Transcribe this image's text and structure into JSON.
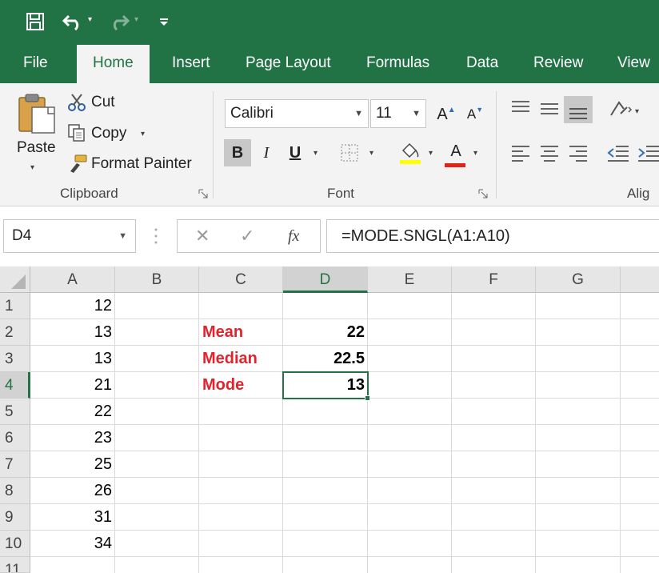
{
  "quick_access": {
    "colors": {
      "ribbon_green": "#217346",
      "ribbon_bg": "#f3f3f3",
      "label_red": "#e0242e"
    }
  },
  "tabs": [
    {
      "label": "File"
    },
    {
      "label": "Home"
    },
    {
      "label": "Insert"
    },
    {
      "label": "Page Layout"
    },
    {
      "label": "Formulas"
    },
    {
      "label": "Data"
    },
    {
      "label": "Review"
    },
    {
      "label": "View"
    }
  ],
  "ribbon": {
    "clipboard": {
      "paste_label": "Paste",
      "cut_label": "Cut",
      "copy_label": "Copy",
      "format_painter_label": "Format Painter",
      "group_label": "Clipboard"
    },
    "font": {
      "font_name": "Calibri",
      "font_size": "11",
      "bold_label": "B",
      "italic_label": "I",
      "underline_label": "U",
      "grow_label": "A",
      "shrink_label": "A",
      "font_color_label": "A",
      "group_label": "Font"
    },
    "alignment": {
      "group_label": "Alig"
    }
  },
  "formula_bar": {
    "name_box": "D4",
    "fx_label": "fx",
    "formula": "=MODE.SNGL(A1:A10)"
  },
  "sheet": {
    "columns": [
      "A",
      "B",
      "C",
      "D",
      "E",
      "F",
      "G"
    ],
    "rows": [
      "1",
      "2",
      "3",
      "4",
      "5",
      "6",
      "7",
      "8",
      "9",
      "10",
      "11"
    ],
    "col_a_values": [
      "12",
      "13",
      "13",
      "21",
      "22",
      "23",
      "25",
      "26",
      "31",
      "34"
    ],
    "stats": [
      {
        "label": "Mean",
        "value": "22"
      },
      {
        "label": "Median",
        "value": "22.5"
      },
      {
        "label": "Mode",
        "value": "13"
      }
    ],
    "selected_cell": "D4"
  }
}
